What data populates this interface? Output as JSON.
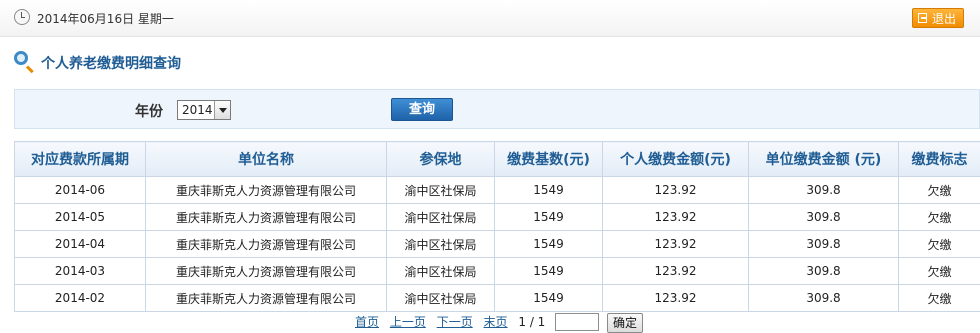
{
  "header": {
    "date": "2014年06月16日 星期一",
    "logout_label": "退出",
    "clock_icon": "clock-icon",
    "logout_icon": "exit-icon"
  },
  "page": {
    "title": "个人养老缴费明细查询",
    "title_icon": "magnifier-icon"
  },
  "search": {
    "year_label": "年份",
    "year_value": "2014",
    "query_label": "查询"
  },
  "table": {
    "headers": [
      "对应费款所属期",
      "单位名称",
      "参保地",
      "缴费基数(元)",
      "个人缴费金额(元)",
      "单位缴费金额 (元)",
      "缴费标志"
    ],
    "rows": [
      [
        "2014-06",
        "重庆菲斯克人力资源管理有限公司",
        "渝中区社保局",
        "1549",
        "123.92",
        "309.8",
        "欠缴"
      ],
      [
        "2014-05",
        "重庆菲斯克人力资源管理有限公司",
        "渝中区社保局",
        "1549",
        "123.92",
        "309.8",
        "欠缴"
      ],
      [
        "2014-04",
        "重庆菲斯克人力资源管理有限公司",
        "渝中区社保局",
        "1549",
        "123.92",
        "309.8",
        "欠缴"
      ],
      [
        "2014-03",
        "重庆菲斯克人力资源管理有限公司",
        "渝中区社保局",
        "1549",
        "123.92",
        "309.8",
        "欠缴"
      ],
      [
        "2014-02",
        "重庆菲斯克人力资源管理有限公司",
        "渝中区社保局",
        "1549",
        "123.92",
        "309.8",
        "欠缴"
      ]
    ]
  },
  "pager": {
    "first": "首页",
    "prev": "上一页",
    "next": "下一页",
    "last": "末页",
    "page_info": "1 / 1",
    "go_label": "确定"
  },
  "colors": {
    "accent": "#1f5d94",
    "logout": "#f08c00",
    "query_button": "#2a72bd"
  }
}
